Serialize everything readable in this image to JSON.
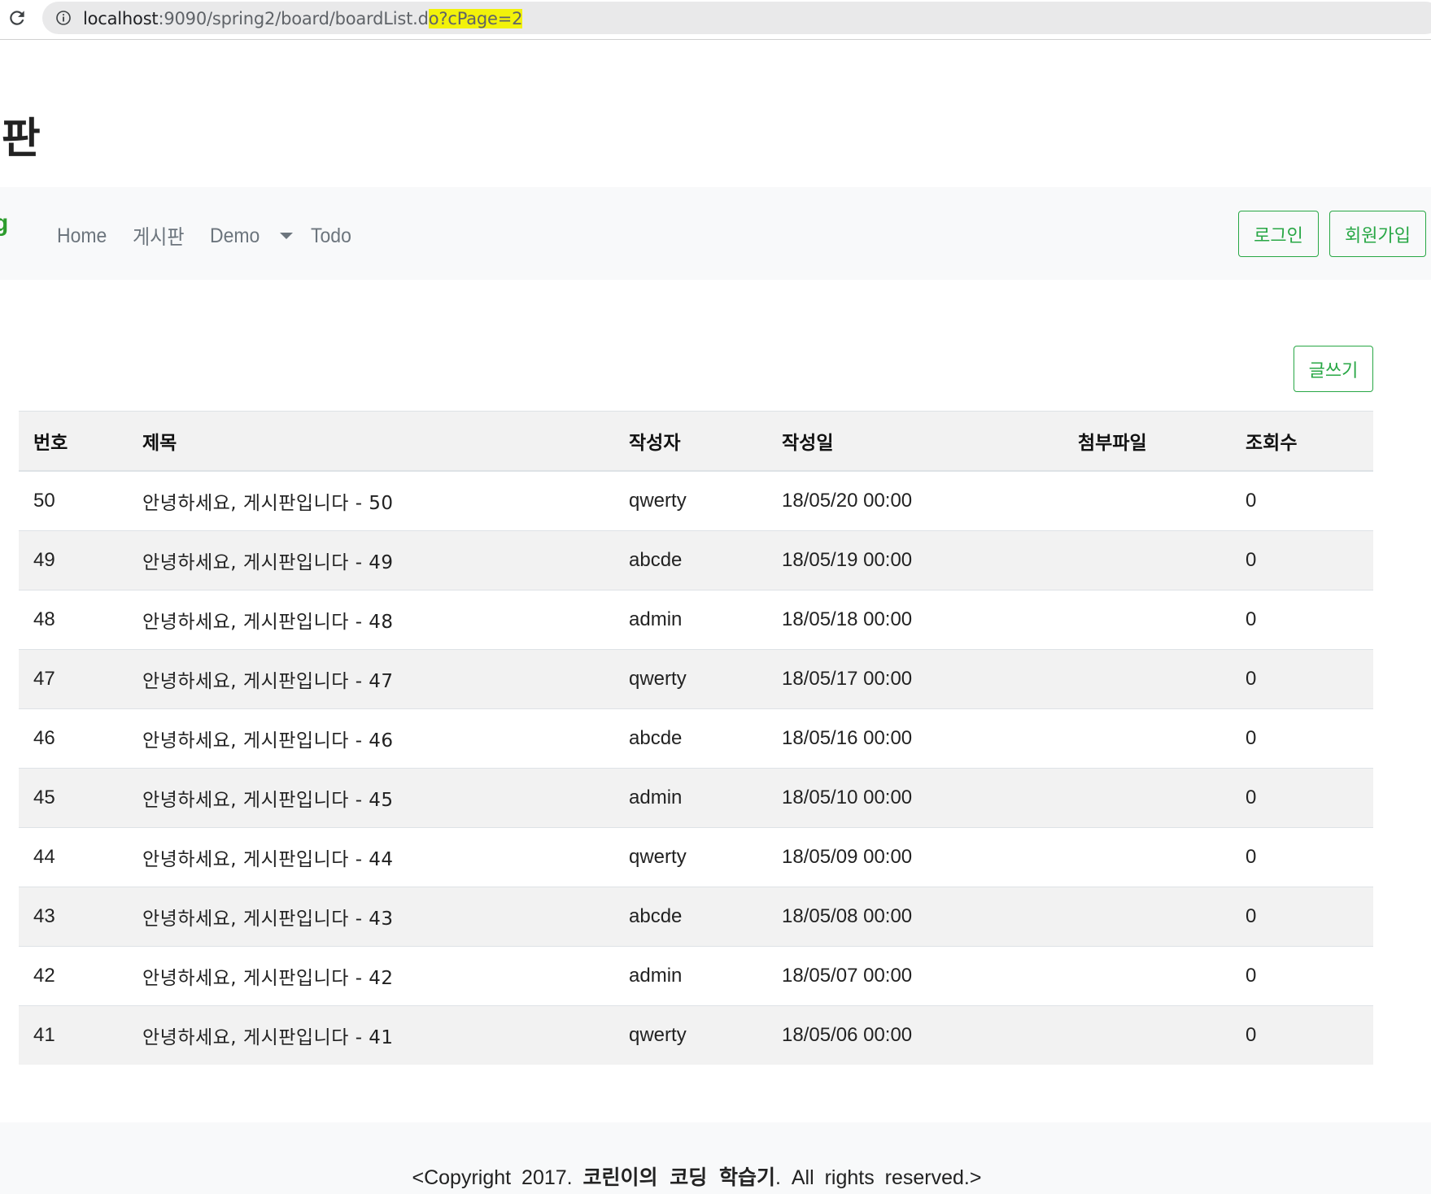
{
  "browser": {
    "url_host": "localhost",
    "url_path": ":9090/spring2/board/boardList.d",
    "url_highlight": "o?cPage=2"
  },
  "header": {
    "title": "시판"
  },
  "navbar": {
    "brand": "g",
    "links": [
      "Home",
      "게시판",
      "Demo",
      "Todo"
    ],
    "login_label": "로그인",
    "signup_label": "회원가입"
  },
  "board": {
    "write_label": "글쓰기",
    "columns": [
      "번호",
      "제목",
      "작성자",
      "작성일",
      "첨부파일",
      "조회수"
    ],
    "rows": [
      {
        "no": "50",
        "title": "안녕하세요, 게시판입니다 - 50",
        "writer": "qwerty",
        "date": "18/05/20 00:00",
        "file": "",
        "count": "0"
      },
      {
        "no": "49",
        "title": "안녕하세요, 게시판입니다 - 49",
        "writer": "abcde",
        "date": "18/05/19 00:00",
        "file": "",
        "count": "0"
      },
      {
        "no": "48",
        "title": "안녕하세요, 게시판입니다 - 48",
        "writer": "admin",
        "date": "18/05/18 00:00",
        "file": "",
        "count": "0"
      },
      {
        "no": "47",
        "title": "안녕하세요, 게시판입니다 - 47",
        "writer": "qwerty",
        "date": "18/05/17 00:00",
        "file": "",
        "count": "0"
      },
      {
        "no": "46",
        "title": "안녕하세요, 게시판입니다 - 46",
        "writer": "abcde",
        "date": "18/05/16 00:00",
        "file": "",
        "count": "0"
      },
      {
        "no": "45",
        "title": "안녕하세요, 게시판입니다 - 45",
        "writer": "admin",
        "date": "18/05/10 00:00",
        "file": "",
        "count": "0"
      },
      {
        "no": "44",
        "title": "안녕하세요, 게시판입니다 - 44",
        "writer": "qwerty",
        "date": "18/05/09 00:00",
        "file": "",
        "count": "0"
      },
      {
        "no": "43",
        "title": "안녕하세요, 게시판입니다 - 43",
        "writer": "abcde",
        "date": "18/05/08 00:00",
        "file": "",
        "count": "0"
      },
      {
        "no": "42",
        "title": "안녕하세요, 게시판입니다 - 42",
        "writer": "admin",
        "date": "18/05/07 00:00",
        "file": "",
        "count": "0"
      },
      {
        "no": "41",
        "title": "안녕하세요, 게시판입니다 - 41",
        "writer": "qwerty",
        "date": "18/05/06 00:00",
        "file": "",
        "count": "0"
      }
    ]
  },
  "footer": {
    "prefix": "<Copyright 2017. ",
    "brand": "코린이의 코딩 학습기",
    "suffix": ". All rights reserved.>"
  },
  "colors": {
    "accent": "#28a745",
    "navbar_bg": "#f8f9fa",
    "stripe": "#f2f2f2",
    "url_highlight": "#f2f20a"
  },
  "icons": [
    "reload-icon",
    "info-icon",
    "caret-down-icon"
  ]
}
